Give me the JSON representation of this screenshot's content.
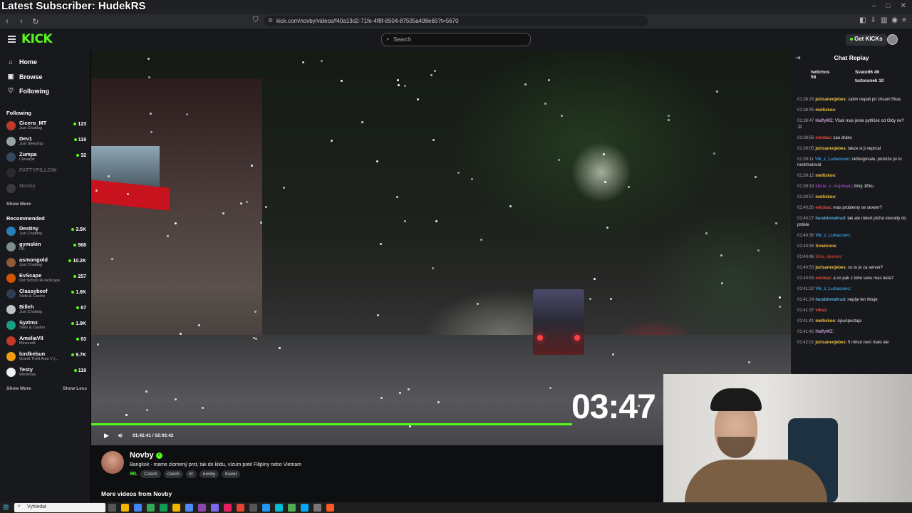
{
  "overlay": {
    "title": "Latest Subscriber: HudekRS"
  },
  "browser": {
    "url": "kick.com/novby/videos/f40a13d2-71fe-4f8f-8504-87505a498e65?t=5670"
  },
  "header": {
    "logo": "KICK",
    "search_placeholder": "Search",
    "get_kicks": "Get KICKs"
  },
  "sidebar": {
    "nav": [
      {
        "label": "Home"
      },
      {
        "label": "Browse"
      },
      {
        "label": "Following"
      }
    ],
    "following_title": "Following",
    "following": [
      {
        "name": "Cicero_MT",
        "category": "Just Chatting",
        "viewers": "123",
        "color": "#c0392b"
      },
      {
        "name": "Dev1",
        "category": "Just Sleeping",
        "viewers": "119",
        "color": "#95a5a6"
      },
      {
        "name": "Zumpa",
        "category": "Cleverpit",
        "viewers": "32",
        "color": "#34495e"
      },
      {
        "name": "FATTYPILLOW",
        "category": "",
        "viewers": "",
        "color": "#555"
      },
      {
        "name": "Novby",
        "category": "",
        "viewers": "",
        "color": "#888"
      }
    ],
    "show_more_1": "Show More",
    "recommended_title": "Recommended",
    "recommended": [
      {
        "name": "Destiny",
        "category": "Just Chatting",
        "viewers": "3.5K",
        "color": "#2980b9"
      },
      {
        "name": "gymskin",
        "category": "IRL",
        "viewers": "968",
        "color": "#7f8c8d"
      },
      {
        "name": "asmongold",
        "category": "Just Chatting",
        "viewers": "10.2K",
        "color": "#8e5a3c"
      },
      {
        "name": "EvScape",
        "category": "Old School RuneScape",
        "viewers": "257",
        "color": "#d35400"
      },
      {
        "name": "Classybeef",
        "category": "Slots & Casino",
        "viewers": "1.6K",
        "color": "#2c3e50"
      },
      {
        "name": "Billeh",
        "category": "Just Chatting",
        "viewers": "67",
        "color": "#bdc3c7"
      },
      {
        "name": "Syztmz",
        "category": "Slots & Casino",
        "viewers": "1.9K",
        "color": "#16a085"
      },
      {
        "name": "AmeliaVII",
        "category": "Minecraft",
        "viewers": "63",
        "color": "#c0392b"
      },
      {
        "name": "lordkebun",
        "category": "Grand Theft Auto V (...",
        "viewers": "9.7K",
        "color": "#f39c12"
      },
      {
        "name": "Testy",
        "category": "Windrose",
        "viewers": "119",
        "color": "#ecf0f1"
      }
    ],
    "show_more_2": "Show More",
    "show_less": "Show Less"
  },
  "player": {
    "big_timer": "03:47",
    "time": "01:42:41 / 02:02:42",
    "progress": 0.84
  },
  "stream": {
    "name": "Novby",
    "title": "Bangkok - mame zlomený prst, tak do klidu,  vízum poté Filipíny nebo Vietnam",
    "category": "IRL",
    "tags": [
      "Czech",
      "czech",
      "irl",
      "novby",
      "travel"
    ],
    "more_videos": "More videos from Novby"
  },
  "chat": {
    "title": "Chat Replay",
    "leaders": [
      {
        "name": "twitchos",
        "count": "58"
      },
      {
        "name": "Svato96",
        "count": "46"
      },
      {
        "name": "turbosnek",
        "count": "10"
      }
    ],
    "messages": [
      {
        "time": "01:38:29",
        "user": "jezisaneojebes",
        "color": "#f0c040",
        "text": "zatim nepali pri chcaní říkas"
      },
      {
        "time": "01:38:35",
        "user": "melliskoo",
        "color": "#f0c040",
        "text": ""
      },
      {
        "time": "01:38:47",
        "user": "HaffyWZ",
        "color": "#c39bd3",
        "text": "Však mas jeste pytlíček od Oldy ne? :D"
      },
      {
        "time": "01:38:56",
        "user": "evickax",
        "color": "#e74c3c",
        "text": "cau draku"
      },
      {
        "time": "01:39:05",
        "user": "jezisaneojebes",
        "color": "#f0c040",
        "text": "takze si ji neprcal"
      },
      {
        "time": "01:39:11",
        "user": "Vik_z_Luhacovic",
        "color": "#3498db",
        "text": "nefungovalo, protože jsi to nestimuloval"
      },
      {
        "time": "01:39:12",
        "user": "melliskoo",
        "color": "#f0c040",
        "text": ""
      },
      {
        "time": "01:39:13",
        "user": "kliste_v_trojobalu",
        "color": "#8e44ad",
        "text": "Ahoj Jiříku"
      },
      {
        "time": "01:39:57",
        "user": "melliskoo",
        "color": "#f0c040",
        "text": ""
      },
      {
        "time": "01:40:20",
        "user": "evickax",
        "color": "#e74c3c",
        "text": "mas problemy se sexem?"
      },
      {
        "time": "01:40:27",
        "user": "harabinnahrad",
        "color": "#5dade2",
        "text": "tak ale robert píchá steroidy do prdele"
      },
      {
        "time": "01:40:36",
        "user": "Vik_z_Luhacovic",
        "color": "#3498db",
        "text": ""
      },
      {
        "time": "01:40:46",
        "user": "Smekrone",
        "color": "#f5b041",
        "text": ""
      },
      {
        "time": "01:40:46",
        "user": "Slinj_demon",
        "color": "#c0392b",
        "text": ""
      },
      {
        "time": "01:40:53",
        "user": "jezisaneojebes",
        "color": "#f0c040",
        "text": "co to je za server?"
      },
      {
        "time": "01:40:53",
        "user": "evickax",
        "color": "#e74c3c",
        "text": "a co pak z toho sexu mas teda?"
      },
      {
        "time": "01:41:22",
        "user": "Vik_z_Luhacovic",
        "color": "#3498db",
        "text": ""
      },
      {
        "time": "01:41:24",
        "user": "harabinnahrad",
        "color": "#5dade2",
        "text": "nepíje len fetuje"
      },
      {
        "time": "01:41:37",
        "user": "viksu",
        "color": "#e74c3c",
        "text": ""
      },
      {
        "time": "01:41:41",
        "user": "melliskoo",
        "color": "#f0c040",
        "text": "ApuApustaja"
      },
      {
        "time": "01:41:42",
        "user": "HaffyWZ",
        "color": "#c39bd3",
        "text": ""
      },
      {
        "time": "01:42:02",
        "user": "jezisaneojebes",
        "color": "#f0c040",
        "text": "5 minut není malo ale"
      }
    ]
  },
  "taskbar": {
    "search_placeholder": "Vyhledat"
  }
}
